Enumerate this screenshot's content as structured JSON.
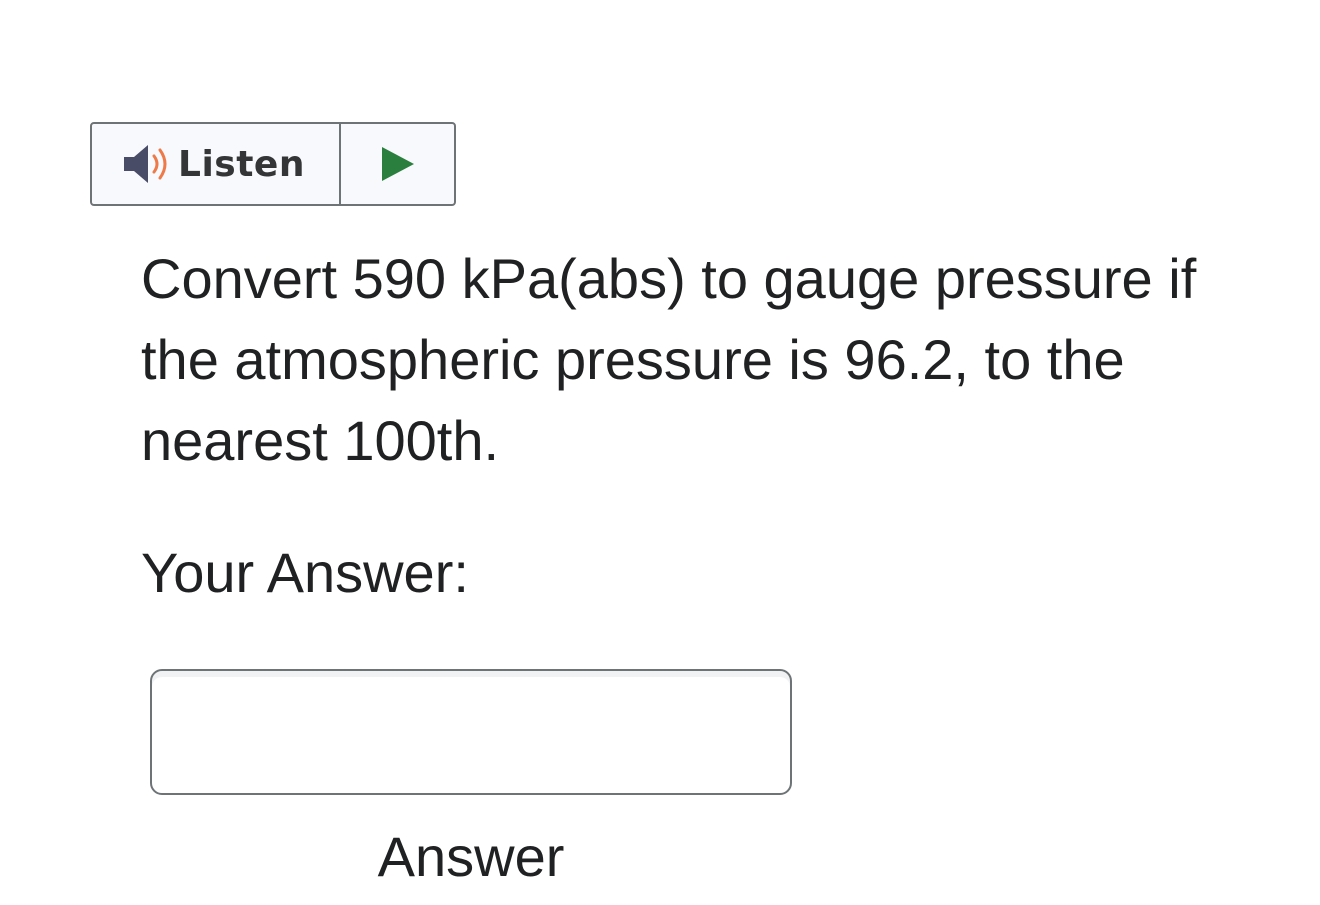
{
  "listen_widget": {
    "label": "Listen",
    "speaker_icon": "speaker-icon",
    "play_icon": "play-icon",
    "colors": {
      "speaker_body": "#494c66",
      "speaker_waves": "#ee7a49",
      "play": "#2b7f3e"
    }
  },
  "question": {
    "text": "Convert 590 kPa(abs) to gauge pressure if the atmospheric pressure is 96.2, to the nearest 100th."
  },
  "answer": {
    "label": "Your Answer:",
    "input_value": "",
    "input_placeholder": "",
    "caption": "Answer"
  }
}
